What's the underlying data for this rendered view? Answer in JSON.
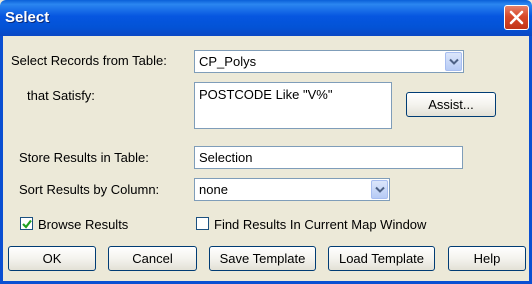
{
  "window": {
    "title": "Select",
    "close_icon": "close-x-icon"
  },
  "select_from": {
    "label": "Select Records from Table:",
    "value": "CP_Polys"
  },
  "satisfy": {
    "label": "that Satisfy:",
    "value": "POSTCODE Like \"V%\""
  },
  "assist_button": "Assist...",
  "store_results": {
    "label": "Store Results in Table:",
    "value": "Selection"
  },
  "sort_results": {
    "label": "Sort Results by Column:",
    "value": "none"
  },
  "browse_results": {
    "label": "Browse Results",
    "checked": true
  },
  "find_results": {
    "label": "Find Results In Current Map Window",
    "checked": false
  },
  "buttons": {
    "ok": "OK",
    "cancel": "Cancel",
    "save_template": "Save Template",
    "load_template": "Load Template",
    "help": "Help"
  },
  "colors": {
    "titlebar": "#0353d6",
    "dialog_bg": "#ece9d8",
    "close": "#d8492a",
    "check": "#21a121"
  }
}
